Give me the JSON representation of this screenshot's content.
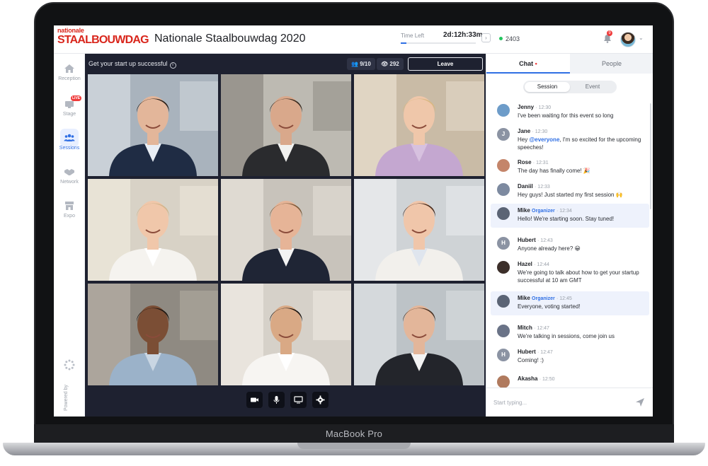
{
  "device": {
    "label": "MacBook Pro"
  },
  "header": {
    "logo_small": "nationale",
    "logo_big": "STAALBOUWDAG",
    "event_title": "Nationale Staalbouwdag 2020",
    "time_left_label": "Time Left",
    "timer": "2d:12h:33m",
    "time_progress_pct": 8,
    "viewer_count": "2403",
    "notification_count": "9"
  },
  "sidebar": {
    "items": [
      {
        "label": "Reception",
        "icon": "home-icon"
      },
      {
        "label": "Stage",
        "icon": "stage-icon",
        "badge": "LIVE"
      },
      {
        "label": "Sessions",
        "icon": "people-icon"
      },
      {
        "label": "Network",
        "icon": "handshake-icon"
      },
      {
        "label": "Expo",
        "icon": "store-icon"
      }
    ],
    "active": "Sessions",
    "powered_by": "Powered by"
  },
  "session": {
    "title": "Get your start up successful",
    "participants": "9/10",
    "views": "292",
    "leave_label": "Leave"
  },
  "controls": [
    "camera-icon",
    "microphone-icon",
    "screen-share-icon",
    "settings-icon"
  ],
  "chat": {
    "tabs": {
      "chat": "Chat",
      "people": "People"
    },
    "segments": {
      "session": "Session",
      "event": "Event"
    },
    "messages": [
      {
        "name": "Jenny",
        "time": "12:30",
        "text": "I've been waiting for this event so long",
        "avatar_color": "#6d9cc9"
      },
      {
        "name": "Jane",
        "time": "12:30",
        "mention": "@everyone",
        "text": ", I'm so excited for the upcoming speeches!",
        "text_prefix": "Hey ",
        "initial": "J",
        "avatar_color": "#8b93a3"
      },
      {
        "name": "Rose",
        "time": "12:31",
        "text": "The day has finally come! 🎉",
        "avatar_color": "#c4856a"
      },
      {
        "name": "Daniil",
        "time": "12:33",
        "text": "Hey guys! Just started my first session 🙌",
        "avatar_color": "#7d8aa0"
      },
      {
        "name": "Mike",
        "role": "Organizer",
        "time": "12:34",
        "text": "Hello! We're starting soon. Stay tuned!",
        "avatar_color": "#5b6475"
      },
      {
        "name": "Hubert",
        "time": "12:43",
        "text": "Anyone already here? 😀",
        "initial": "H",
        "avatar_color": "#8b93a3"
      },
      {
        "name": "Hazel",
        "time": "12:44",
        "text": "We're going to talk about how to get your startup successful at 10 am GMT",
        "avatar_color": "#3c2f2a"
      },
      {
        "name": "Mike",
        "role": "Organizer",
        "time": "12:45",
        "text": "Everyone, voting started!",
        "avatar_color": "#5b6475"
      },
      {
        "name": "Mitch",
        "time": "12:47",
        "text": "We're talking in sessions, come join us",
        "avatar_color": "#6a7387"
      },
      {
        "name": "Hubert",
        "time": "12:47",
        "text": "Coming! :)",
        "initial": "H",
        "avatar_color": "#8b93a3"
      },
      {
        "name": "Akasha",
        "time": "12:50",
        "text": "",
        "avatar_color": "#b07a5e"
      }
    ],
    "input_placeholder": "Start typing..."
  },
  "colors": {
    "accent": "#2f6fe4",
    "brand": "#d9261c",
    "video_bg": "#1e2130",
    "live": "#ef3b3b"
  }
}
